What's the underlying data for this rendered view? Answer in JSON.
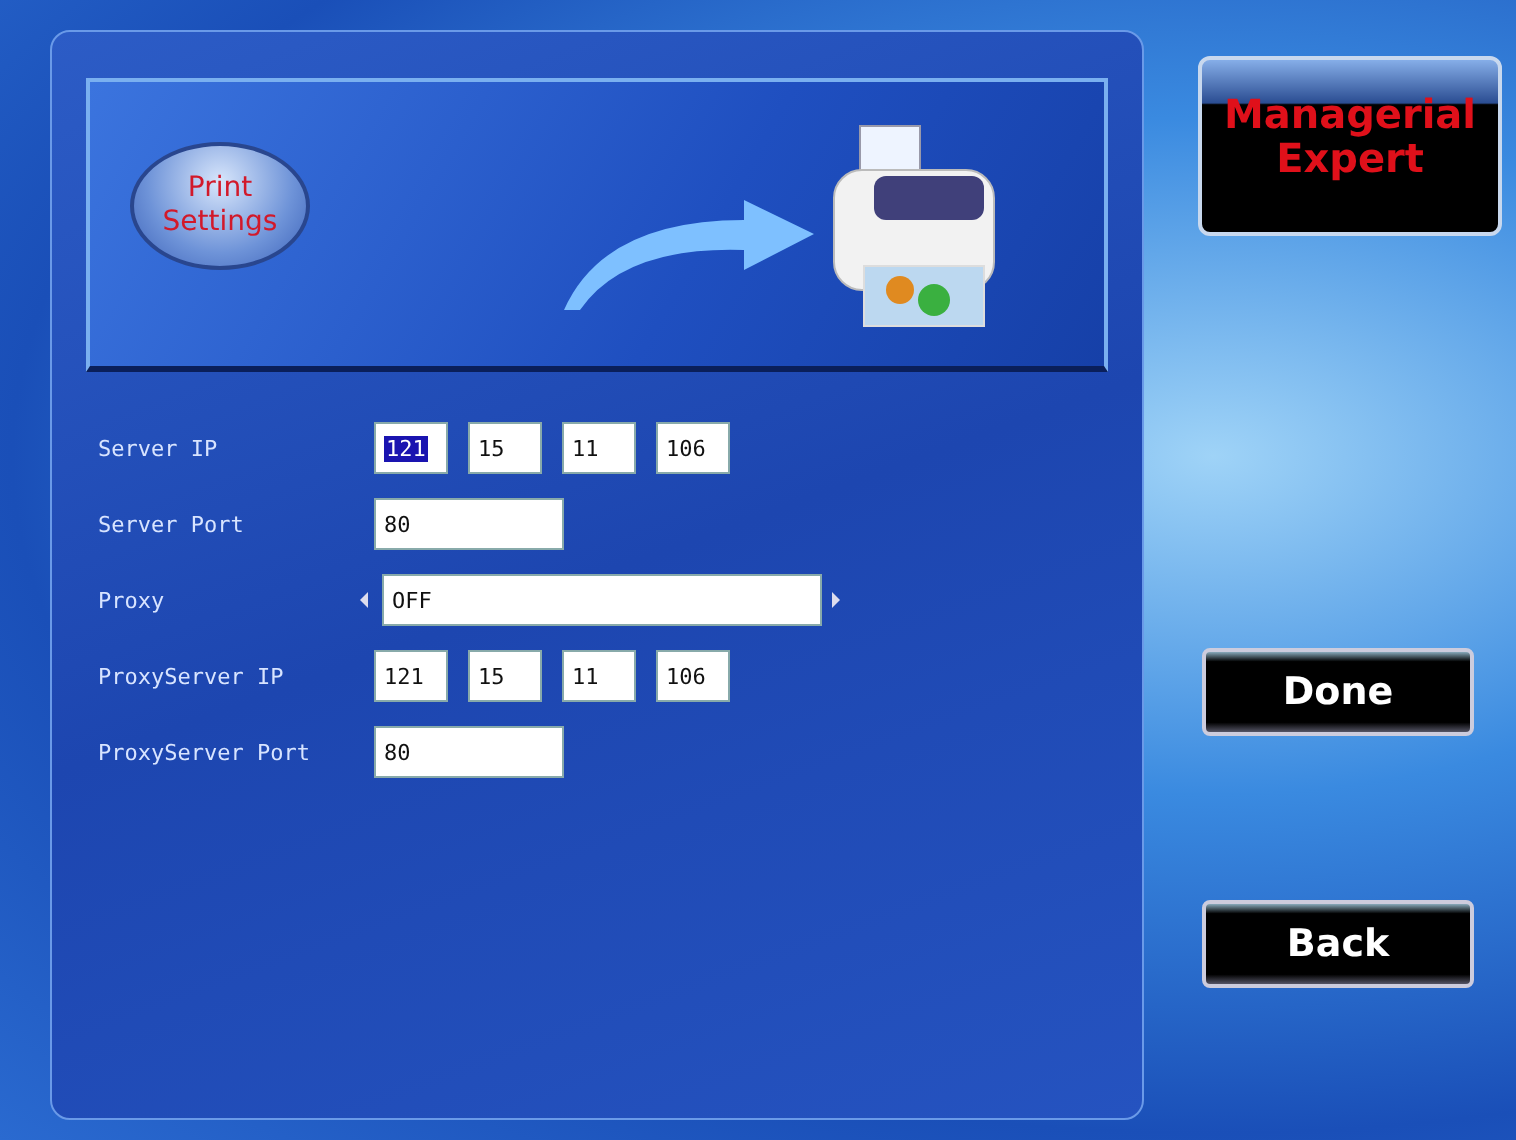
{
  "banner": {
    "title": "Print Settings"
  },
  "fields": [
    {
      "kind": "ip",
      "label": "Server IP",
      "octets": [
        {
          "value": "121",
          "selected": true
        },
        {
          "value": "15",
          "selected": false
        },
        {
          "value": "11",
          "selected": false
        },
        {
          "value": "106",
          "selected": false
        }
      ]
    },
    {
      "kind": "text",
      "label": "Server Port",
      "value": "80"
    },
    {
      "kind": "select",
      "label": "Proxy",
      "value": "OFF"
    },
    {
      "kind": "ip",
      "label": "ProxyServer IP",
      "octets": [
        {
          "value": "121",
          "selected": false
        },
        {
          "value": "15",
          "selected": false
        },
        {
          "value": "11",
          "selected": false
        },
        {
          "value": "106",
          "selected": false
        }
      ]
    },
    {
      "kind": "text",
      "label": "ProxyServer Port",
      "value": "80"
    }
  ],
  "badge": {
    "title": "Managerial Expert"
  },
  "buttons": [
    "Done",
    "Back"
  ]
}
